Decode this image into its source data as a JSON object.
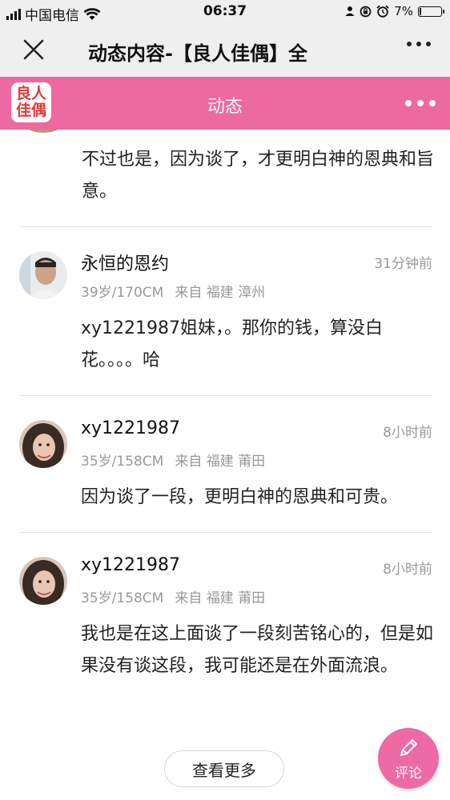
{
  "status_bar": {
    "carrier": "中国电信",
    "time": "06:37",
    "battery": "7%",
    "battery_level": 0.07
  },
  "nav": {
    "title": "动态内容-【良人佳偶】全",
    "close_icon": "close-icon",
    "more_icon": "more-icon"
  },
  "app_header": {
    "logo_line1": "良人",
    "logo_line2": "佳偶",
    "title": "动态",
    "accent_color": "#ec6aa0"
  },
  "comments_top": {
    "body": "不过也是，因为谈了，才更明白神的恩典和旨意。"
  },
  "comments": [
    {
      "name": "永恒的恩约",
      "time": "31分钟前",
      "age_height": "39岁/170CM",
      "origin": "来自 福建 漳州",
      "body": "xy1221987姐妹，。那你的钱，算没白花。。。。哈"
    },
    {
      "name": "xy1221987",
      "time": "8小时前",
      "age_height": "35岁/158CM",
      "origin": "来自 福建 莆田",
      "body": "因为谈了一段，更明白神的恩典和可贵。"
    },
    {
      "name": "xy1221987",
      "time": "8小时前",
      "age_height": "35岁/158CM",
      "origin": "来自 福建 莆田",
      "body": "我也是在这上面谈了一段刻苦铭心的，但是如果没有谈这段，我可能还是在外面流浪。"
    }
  ],
  "load_more": "查看更多",
  "comment_fab": "评论"
}
